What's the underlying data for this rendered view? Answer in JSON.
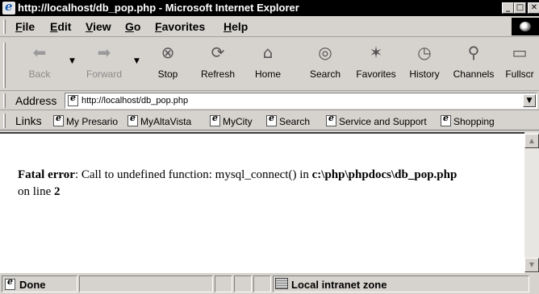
{
  "window": {
    "title": "http://localhost/db_pop.php - Microsoft Internet Explorer",
    "minimize": "_",
    "maximize": "□",
    "close": "✕"
  },
  "menu": [
    "File",
    "Edit",
    "View",
    "Go",
    "Favorites",
    "Help"
  ],
  "toolbar": {
    "buttons": [
      {
        "label": "Back",
        "icon": "back-arrow-icon",
        "glyph": "⬅",
        "enabled": false
      },
      {
        "label": "Forward",
        "icon": "forward-arrow-icon",
        "glyph": "➡",
        "enabled": false
      },
      {
        "label": "Stop",
        "icon": "stop-icon",
        "glyph": "⊗",
        "enabled": true
      },
      {
        "label": "Refresh",
        "icon": "refresh-icon",
        "glyph": "⟳",
        "enabled": true
      },
      {
        "label": "Home",
        "icon": "home-icon",
        "glyph": "⌂",
        "enabled": true
      },
      {
        "label": "Search",
        "icon": "search-globe-icon",
        "glyph": "◎",
        "enabled": true
      },
      {
        "label": "Favorites",
        "icon": "favorites-star-icon",
        "glyph": "✶",
        "enabled": true
      },
      {
        "label": "History",
        "icon": "history-icon",
        "glyph": "◷",
        "enabled": true
      },
      {
        "label": "Channels",
        "icon": "channels-satellite-icon",
        "glyph": "⚲",
        "enabled": true
      },
      {
        "label": "Fullscr",
        "icon": "fullscreen-icon",
        "glyph": "▭",
        "enabled": true
      }
    ]
  },
  "address": {
    "label": "Address",
    "url": "http://localhost/db_pop.php"
  },
  "links": {
    "label": "Links",
    "items": [
      "My Presario",
      "MyAltaVista",
      "MyCity",
      "Search",
      "Service and Support",
      "Shopping"
    ]
  },
  "page": {
    "error_label": "Fatal error",
    "error_message": ": Call to undefined function: mysql_connect() in ",
    "error_path": "c:\\php\\phpdocs\\db_pop.php",
    "line_prefix": "on line ",
    "line_number": "2"
  },
  "status": {
    "text": "Done",
    "zone": "Local intranet zone"
  }
}
